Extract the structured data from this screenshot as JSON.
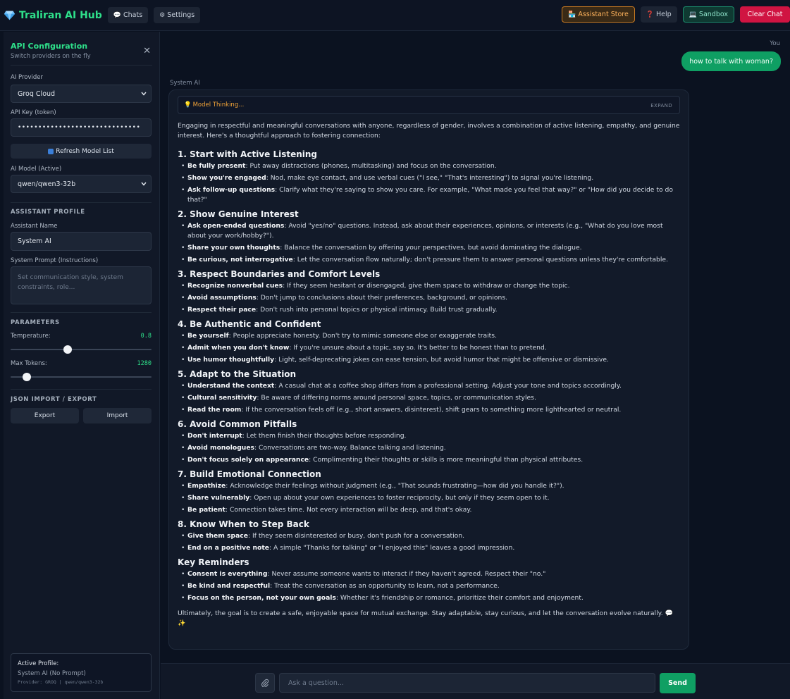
{
  "header": {
    "brand": "Traliran AI Hub",
    "nav": [
      {
        "icon": "chat-bubble-icon",
        "glyph": "💬",
        "label": "Chats"
      },
      {
        "icon": "gear-icon",
        "glyph": "⚙",
        "label": "Settings"
      }
    ],
    "assistant_store": {
      "glyph": "🏪",
      "label": "Assistant Store"
    },
    "help": {
      "glyph": "❓",
      "label": "Help"
    },
    "sandbox": {
      "glyph": "💻",
      "label": "Sandbox"
    },
    "clear_chat": "Clear Chat",
    "colors": {
      "brand": "#2ee08a",
      "store": "#ffb35c",
      "clear": "#d01442"
    }
  },
  "sidebar": {
    "title": "API Configuration",
    "subtitle": "Switch providers on the fly",
    "provider_label": "AI Provider",
    "provider_value": "Groq Cloud",
    "apikey_label": "API Key (token)",
    "apikey_value": "••••••••••••••••••••••••••••••",
    "refresh_label": "Refresh Model List",
    "model_label": "AI Model (Active)",
    "model_value": "qwen/qwen3-32b",
    "profile_section": "ASSISTANT PROFILE",
    "name_label": "Assistant Name",
    "name_value": "System AI",
    "prompt_label": "System Prompt (Instructions)",
    "prompt_placeholder": "Set communication style, system constraints, role...",
    "params_section": "PARAMETERS",
    "temperature_label": "Temperature:",
    "temperature_value": "0.8",
    "temperature_fraction": 0.4,
    "tokens_label": "Max Tokens:",
    "tokens_value": "1280",
    "tokens_fraction": 0.09,
    "json_section": "JSON IMPORT / EXPORT",
    "export_label": "Export",
    "import_label": "Import",
    "active_profile_title": "Active Profile:",
    "active_profile_name": "System AI (No Prompt)",
    "active_profile_provider": "Provider: GROQ | qwen/qwen3-32b"
  },
  "chat": {
    "you_label": "You",
    "user_message": "how to talk with woman?",
    "ai_label": "System AI",
    "thinking_label": "Model Thinking...",
    "expand_label": "EXPAND",
    "intro": "Engaging in respectful and meaningful conversations with anyone, regardless of gender, involves a combination of active listening, empathy, and genuine interest. Here's a thoughtful approach to fostering connection:",
    "sections": [
      {
        "heading": "1. Start with Active Listening",
        "items": [
          {
            "b": "Be fully present",
            "t": ": Put away distractions (phones, multitasking) and focus on the conversation."
          },
          {
            "b": "Show you're engaged",
            "t": ": Nod, make eye contact, and use verbal cues (\"I see,\" \"That's interesting\") to signal you're listening."
          },
          {
            "b": "Ask follow-up questions",
            "t": ": Clarify what they're saying to show you care. For example, \"What made you feel that way?\" or \"How did you decide to do that?\""
          }
        ]
      },
      {
        "heading": "2. Show Genuine Interest",
        "items": [
          {
            "b": "Ask open-ended questions",
            "t": ": Avoid \"yes/no\" questions. Instead, ask about their experiences, opinions, or interests (e.g., \"What do you love most about your work/hobby?\")."
          },
          {
            "b": "Share your own thoughts",
            "t": ": Balance the conversation by offering your perspectives, but avoid dominating the dialogue."
          },
          {
            "b": "Be curious, not interrogative",
            "t": ": Let the conversation flow naturally; don't pressure them to answer personal questions unless they're comfortable."
          }
        ]
      },
      {
        "heading": "3. Respect Boundaries and Comfort Levels",
        "items": [
          {
            "b": "Recognize nonverbal cues",
            "t": ": If they seem hesitant or disengaged, give them space to withdraw or change the topic."
          },
          {
            "b": "Avoid assumptions",
            "t": ": Don't jump to conclusions about their preferences, background, or opinions."
          },
          {
            "b": "Respect their pace",
            "t": ": Don't rush into personal topics or physical intimacy. Build trust gradually."
          }
        ]
      },
      {
        "heading": "4. Be Authentic and Confident",
        "items": [
          {
            "b": "Be yourself",
            "t": ": People appreciate honesty. Don't try to mimic someone else or exaggerate traits."
          },
          {
            "b": "Admit when you don't know",
            "t": ": If you're unsure about a topic, say so. It's better to be honest than to pretend."
          },
          {
            "b": "Use humor thoughtfully",
            "t": ": Light, self-deprecating jokes can ease tension, but avoid humor that might be offensive or dismissive."
          }
        ]
      },
      {
        "heading": "5. Adapt to the Situation",
        "items": [
          {
            "b": "Understand the context",
            "t": ": A casual chat at a coffee shop differs from a professional setting. Adjust your tone and topics accordingly."
          },
          {
            "b": "Cultural sensitivity",
            "t": ": Be aware of differing norms around personal space, topics, or communication styles."
          },
          {
            "b": "Read the room",
            "t": ": If the conversation feels off (e.g., short answers, disinterest), shift gears to something more lighthearted or neutral."
          }
        ]
      },
      {
        "heading": "6. Avoid Common Pitfalls",
        "items": [
          {
            "b": "Don't interrupt",
            "t": ": Let them finish their thoughts before responding."
          },
          {
            "b": "Avoid monologues",
            "t": ": Conversations are two-way. Balance talking and listening."
          },
          {
            "b": "Don't focus solely on appearance",
            "t": ": Complimenting their thoughts or skills is more meaningful than physical attributes."
          }
        ]
      },
      {
        "heading": "7. Build Emotional Connection",
        "items": [
          {
            "b": "Empathize",
            "t": ": Acknowledge their feelings without judgment (e.g., \"That sounds frustrating—how did you handle it?\")."
          },
          {
            "b": "Share vulnerably",
            "t": ": Open up about your own experiences to foster reciprocity, but only if they seem open to it."
          },
          {
            "b": "Be patient",
            "t": ": Connection takes time. Not every interaction will be deep, and that's okay."
          }
        ]
      },
      {
        "heading": "8. Know When to Step Back",
        "items": [
          {
            "b": "Give them space",
            "t": ": If they seem disinterested or busy, don't push for a conversation."
          },
          {
            "b": "End on a positive note",
            "t": ": A simple \"Thanks for talking\" or \"I enjoyed this\" leaves a good impression."
          }
        ]
      },
      {
        "heading": "Key Reminders",
        "items": [
          {
            "b": "Consent is everything",
            "t": ": Never assume someone wants to interact if they haven't agreed. Respect their \"no.\""
          },
          {
            "b": "Be kind and respectful",
            "t": ": Treat the conversation as an opportunity to learn, not a performance."
          },
          {
            "b": "Focus on the person, not your own goals",
            "t": ": Whether it's friendship or romance, prioritize their comfort and enjoyment."
          }
        ]
      }
    ],
    "outro": "Ultimately, the goal is to create a safe, enjoyable space for mutual exchange. Stay adaptable, stay curious, and let the conversation evolve naturally. 💬✨"
  },
  "composer": {
    "placeholder": "Ask a question...",
    "send_label": "Send"
  }
}
